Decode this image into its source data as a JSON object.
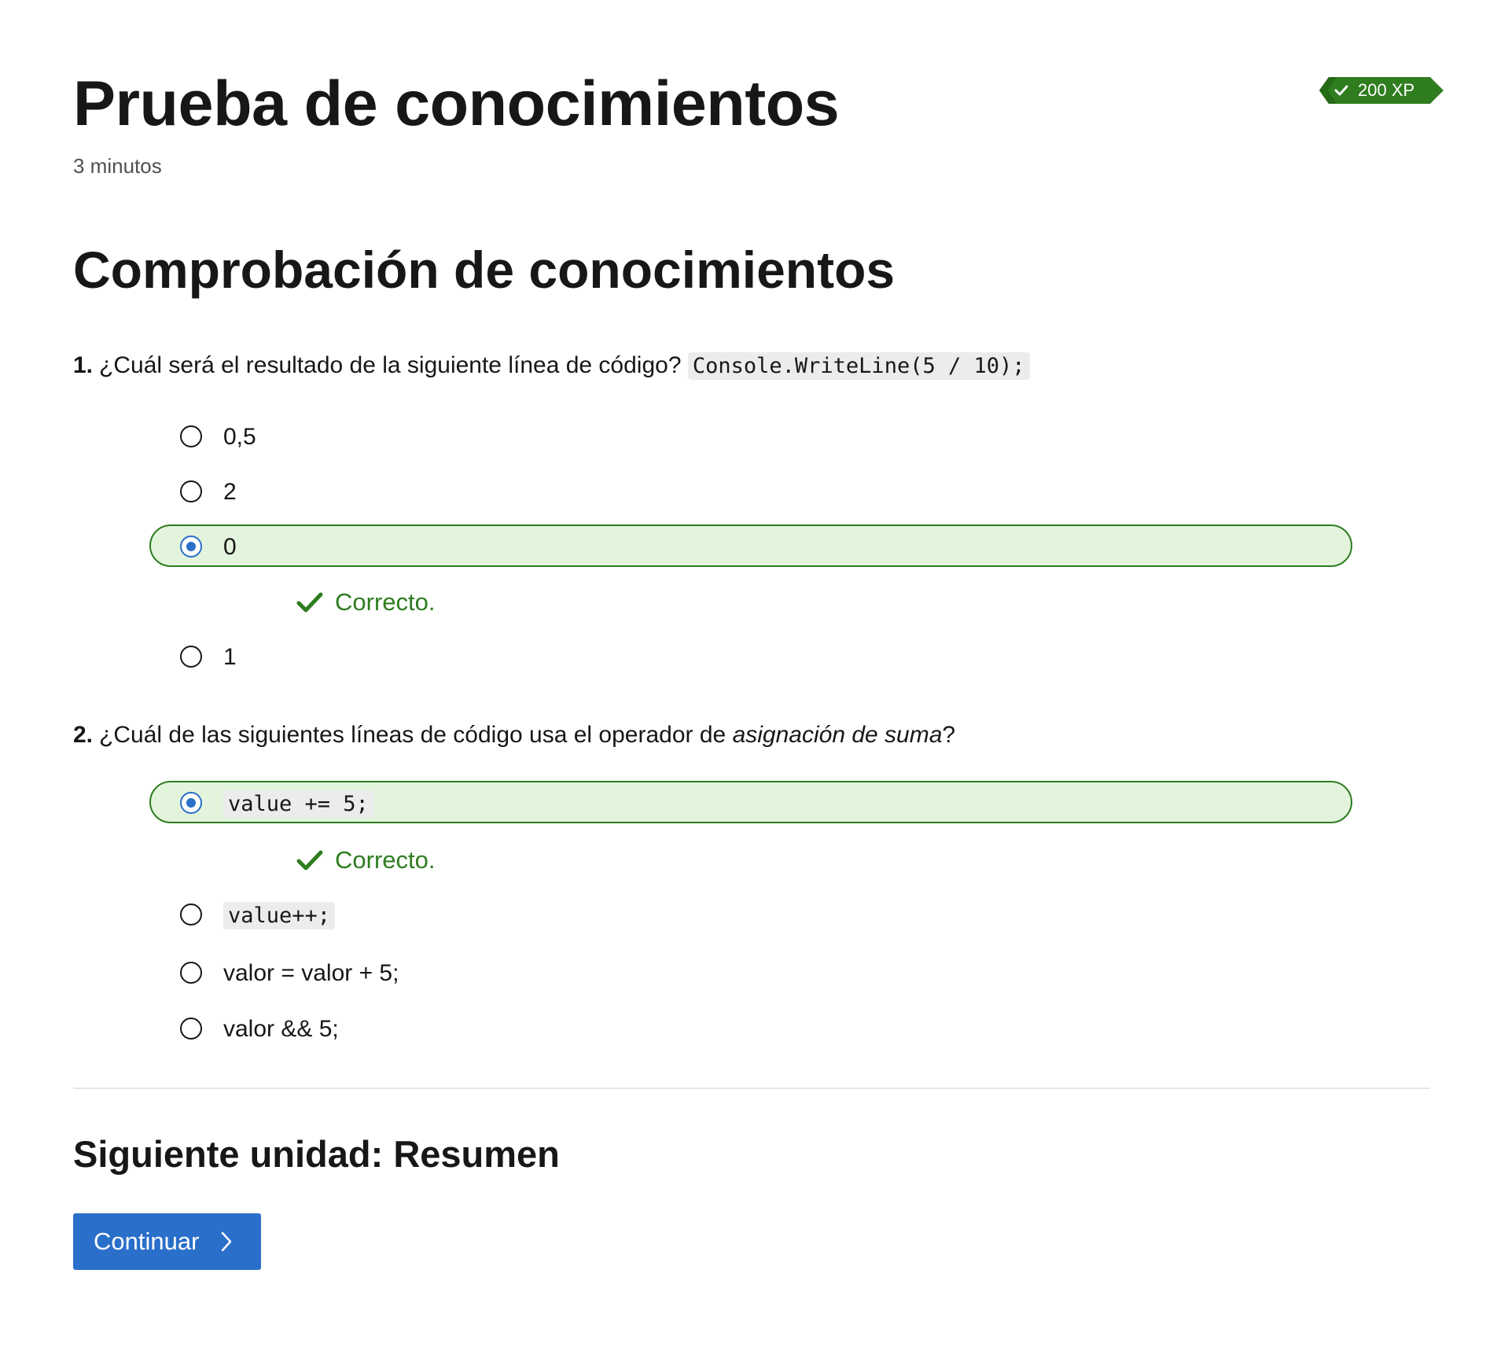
{
  "header": {
    "title": "Prueba de conocimientos",
    "duration": "3 minutos",
    "xp_badge": "200 XP"
  },
  "section_title": "Comprobación de conocimientos",
  "questions": [
    {
      "number": "1.",
      "text": "¿Cuál será el resultado de la siguiente línea de código?",
      "code": "Console.WriteLine(5 / 10);",
      "options": [
        {
          "label": "0,5",
          "selected": false
        },
        {
          "label": "2",
          "selected": false
        },
        {
          "label": "0",
          "selected": true,
          "feedback": "Correcto."
        },
        {
          "label": "1",
          "selected": false
        }
      ]
    },
    {
      "number": "2.",
      "text_before": "¿Cuál de las siguientes líneas de código usa el operador de",
      "text_emphasis": "asignación de suma",
      "text_after": "?",
      "options": [
        {
          "label": "value += 5;",
          "code": true,
          "selected": true,
          "feedback": "Correcto."
        },
        {
          "label": "value++;",
          "code": true,
          "selected": false
        },
        {
          "label": "valor = valor + 5;",
          "code": false,
          "selected": false
        },
        {
          "label": "valor && 5;",
          "code": false,
          "selected": false
        }
      ]
    }
  ],
  "next_unit": "Siguiente unidad: Resumen",
  "continue_label": "Continuar",
  "colors": {
    "correct_green": "#2d7d1f",
    "selected_bg": "#e3f4dd",
    "accent_blue": "#2a6fca",
    "badge_green": "#2f7d1f"
  },
  "icons": {
    "badge_check": "check-icon",
    "feedback": "checkmark-icon",
    "continue": "chevron-right-icon"
  }
}
